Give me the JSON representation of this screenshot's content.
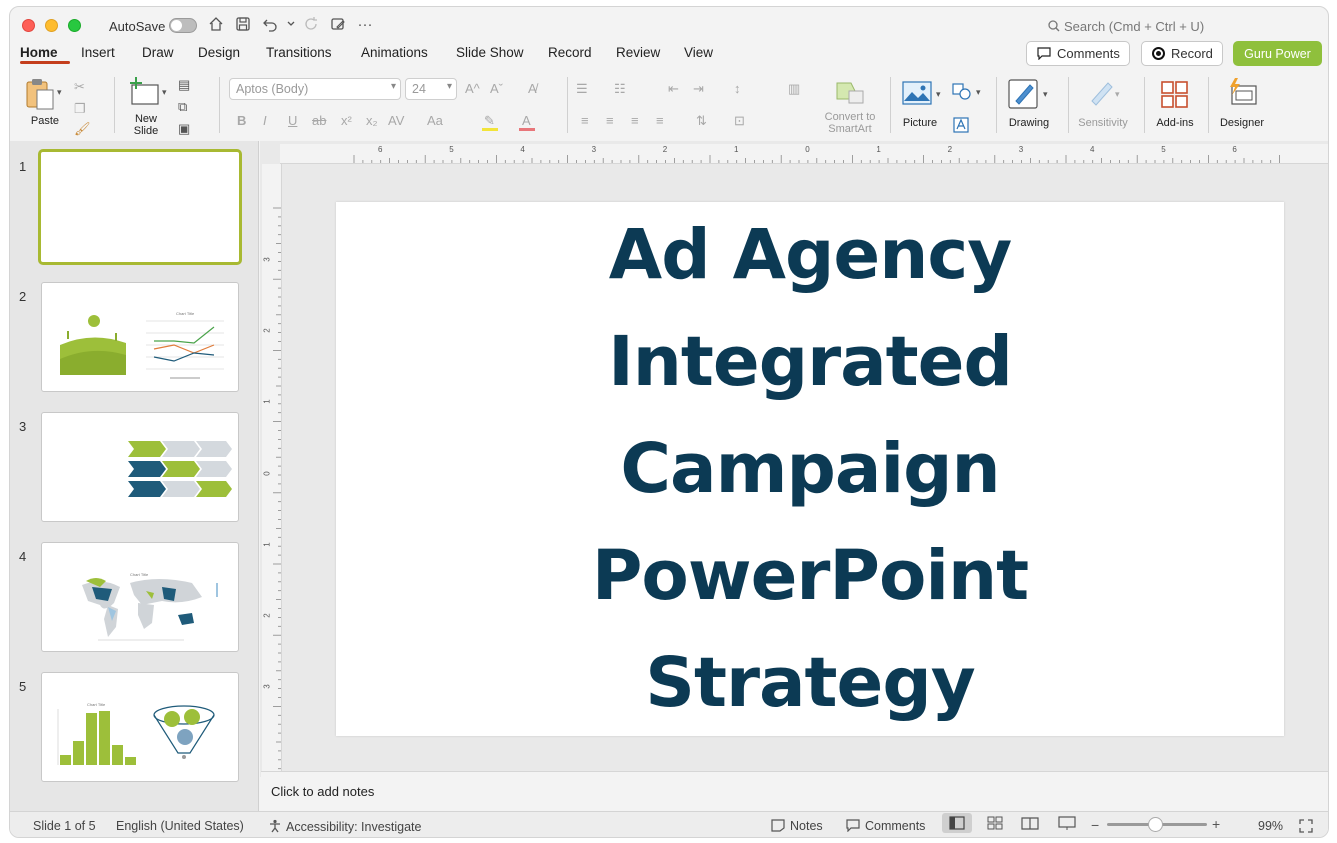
{
  "titlebar": {
    "autosave_label": "AutoSave",
    "search_placeholder": "Search (Cmd + Ctrl + U)",
    "more_glyph": "···"
  },
  "tabs": [
    {
      "label": "Home"
    },
    {
      "label": "Insert"
    },
    {
      "label": "Draw"
    },
    {
      "label": "Design"
    },
    {
      "label": "Transitions"
    },
    {
      "label": "Animations"
    },
    {
      "label": "Slide Show"
    },
    {
      "label": "Record"
    },
    {
      "label": "Review"
    },
    {
      "label": "View"
    }
  ],
  "actions": {
    "comments_label": "Comments",
    "record_label": "Record",
    "guru_label": "Guru Power"
  },
  "ribbon": {
    "paste_label": "Paste",
    "new_slide_label": "New Slide",
    "font_name": "Aptos (Body)",
    "font_size": "24",
    "convert_label": "Convert to SmartArt",
    "picture_label": "Picture",
    "drawing_label": "Drawing",
    "sensitivity_label": "Sensitivity",
    "addins_label": "Add-ins",
    "designer_label": "Designer",
    "bold": "B",
    "italic": "I",
    "underline": "U",
    "strike": "ab",
    "superscript": "x²",
    "subscript": "x₂",
    "spacing": "AV",
    "case": "Aa",
    "grow": "A^",
    "shrink": "Aˇ"
  },
  "ruler": {
    "top_numbers": [
      "6",
      "5",
      "4",
      "3",
      "2",
      "1",
      "0",
      "1",
      "2",
      "3",
      "4",
      "5",
      "6"
    ],
    "left_numbers": [
      "3",
      "2",
      "1",
      "0",
      "1",
      "2",
      "3"
    ]
  },
  "slides": [
    {
      "num": "1"
    },
    {
      "num": "2"
    },
    {
      "num": "3"
    },
    {
      "num": "4"
    },
    {
      "num": "5"
    }
  ],
  "thumb_text": {
    "chart_title": "Chart Title"
  },
  "slide": {
    "title_line1": "Ad Agency Integrated",
    "title_line2": "Campaign PowerPoint",
    "title_line3": "Strategy"
  },
  "notes_placeholder": "Click to add notes",
  "status": {
    "slide_info": "Slide 1 of 5",
    "language": "English (United States)",
    "accessibility": "Accessibility: Investigate",
    "notes_label": "Notes",
    "comments_label": "Comments",
    "zoom": "99%",
    "zoom_minus": "−",
    "zoom_plus": "+"
  },
  "colors": {
    "accent_tab": "#c43e1c",
    "guru_green": "#8fc03c",
    "title_navy": "#0c3a54",
    "thumb_green": "#9dbf3a",
    "thumb_navy": "#1f5b7a"
  }
}
